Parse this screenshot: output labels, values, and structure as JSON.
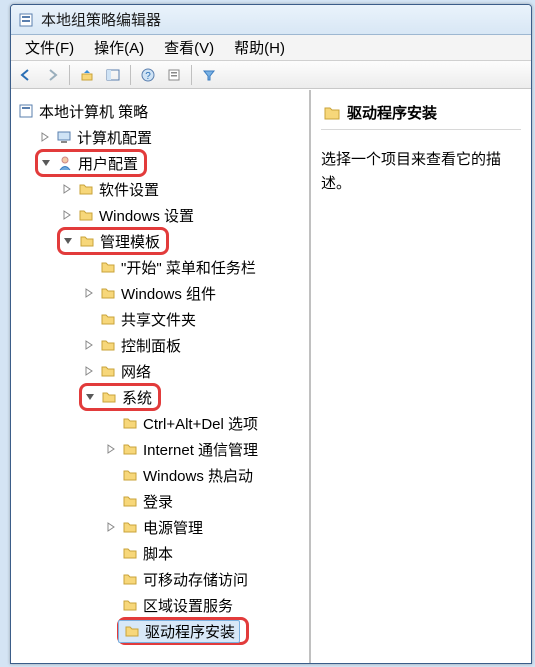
{
  "window": {
    "title": "本地组策略编辑器"
  },
  "menu": {
    "file": "文件(F)",
    "action": "操作(A)",
    "view": "查看(V)",
    "help": "帮助(H)"
  },
  "tree": {
    "root": "本地计算机 策略",
    "computer_config": "计算机配置",
    "user_config": "用户配置",
    "software_settings": "软件设置",
    "windows_settings": "Windows 设置",
    "admin_templates": "管理模板",
    "start_taskbar": "\"开始\" 菜单和任务栏",
    "windows_components": "Windows 组件",
    "shared_folders": "共享文件夹",
    "control_panel": "控制面板",
    "network": "网络",
    "system": "系统",
    "ctrl_alt_del": "Ctrl+Alt+Del 选项",
    "internet_comm": "Internet 通信管理",
    "windows_hotstart": "Windows 热启动",
    "logon": "登录",
    "power_mgmt": "电源管理",
    "scripts": "脚本",
    "removable_storage": "可移动存储访问",
    "locale_services": "区域设置服务",
    "driver_install": "驱动程序安装"
  },
  "detail": {
    "title": "驱动程序安装",
    "body": "选择一个项目来查看它的描述。"
  }
}
